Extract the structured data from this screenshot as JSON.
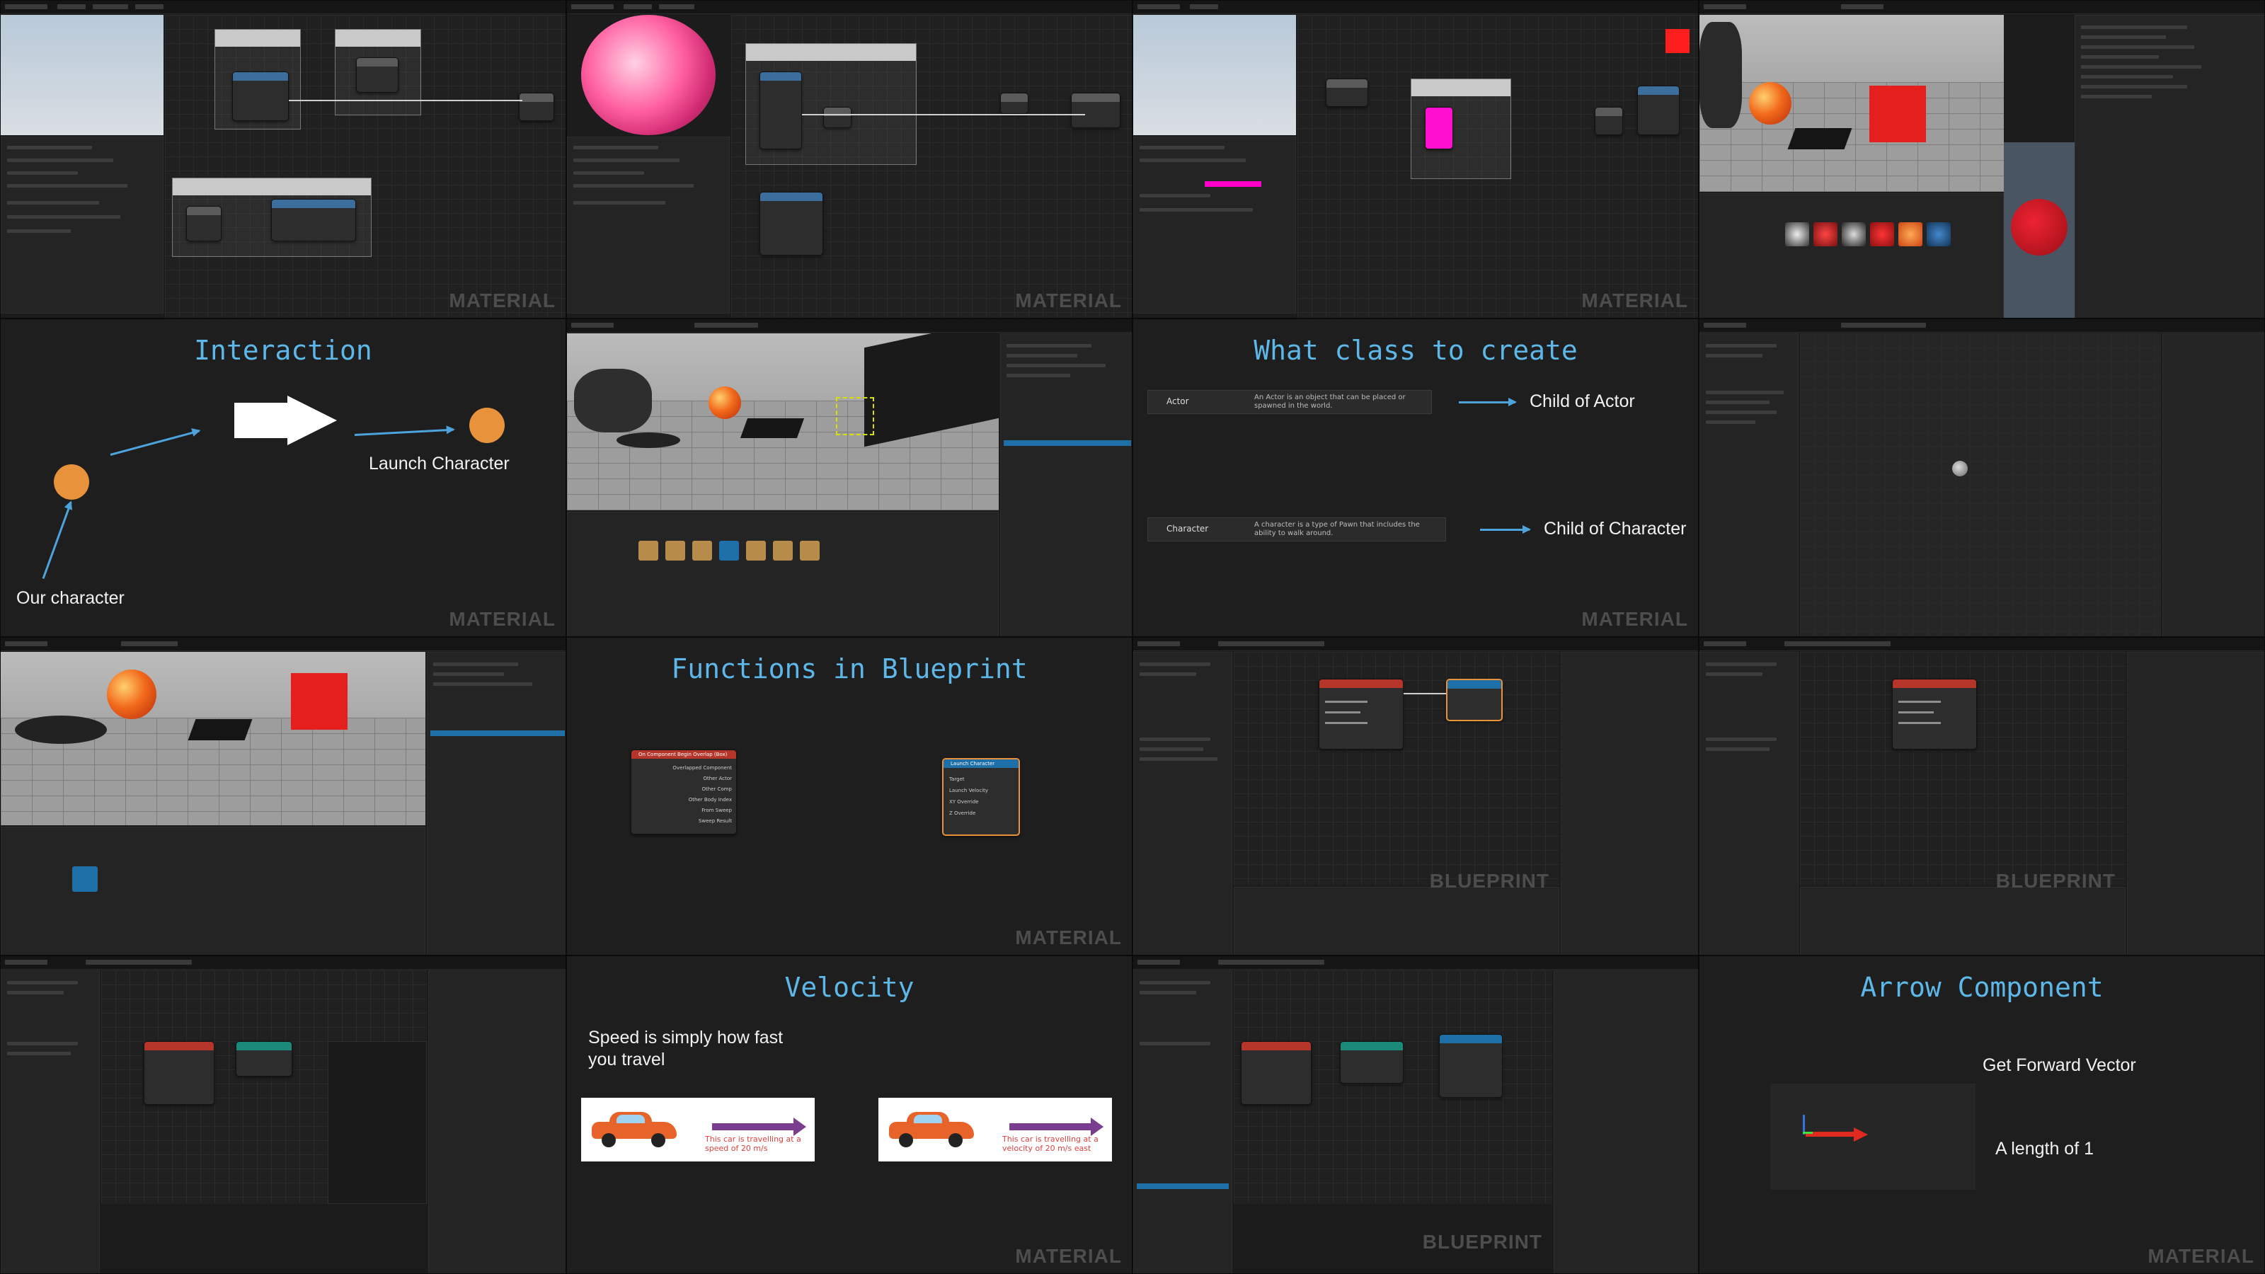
{
  "watermarks": {
    "material": "MATERIAL",
    "blueprint": "BLUEPRINT"
  },
  "slides": {
    "interaction": {
      "title": "Interaction",
      "launch_label": "Launch Character",
      "character_label": "Our character"
    },
    "class": {
      "title": "What class to create",
      "actor_name": "Actor",
      "actor_desc": "An Actor is an object that can be placed or spawned in the world.",
      "actor_child": "Child of Actor",
      "character_name": "Character",
      "character_desc": "A character is a type of Pawn that includes the ability to walk around.",
      "character_child": "Child of Character"
    },
    "functions": {
      "title": "Functions in Blueprint",
      "node_event": "On Component Begin Overlap (Box)",
      "node_event_pins": [
        "Overlapped Component",
        "Other Actor",
        "Other Comp",
        "Other Body Index",
        "From Sweep",
        "Sweep Result"
      ],
      "node_launch": "Launch Character",
      "node_launch_pins": [
        "Target",
        "Launch Velocity",
        "XY Override",
        "Z Override"
      ]
    },
    "velocity": {
      "title": "Velocity",
      "text": "Speed is simply how fast you travel",
      "speed_caption": "This car is travelling at a speed of 20 m/s",
      "velocity_caption": "This car is travelling at a velocity of 20 m/s east"
    },
    "arrow": {
      "title": "Arrow Component",
      "forward": "Get Forward Vector",
      "length": "A length of 1"
    }
  },
  "colors": {
    "title_blue": "#5db7e8",
    "accent_orange": "#e8933c",
    "event_red": "#b5352a",
    "function_blue": "#1f6fa8",
    "arrow_red": "#e02a1f"
  }
}
